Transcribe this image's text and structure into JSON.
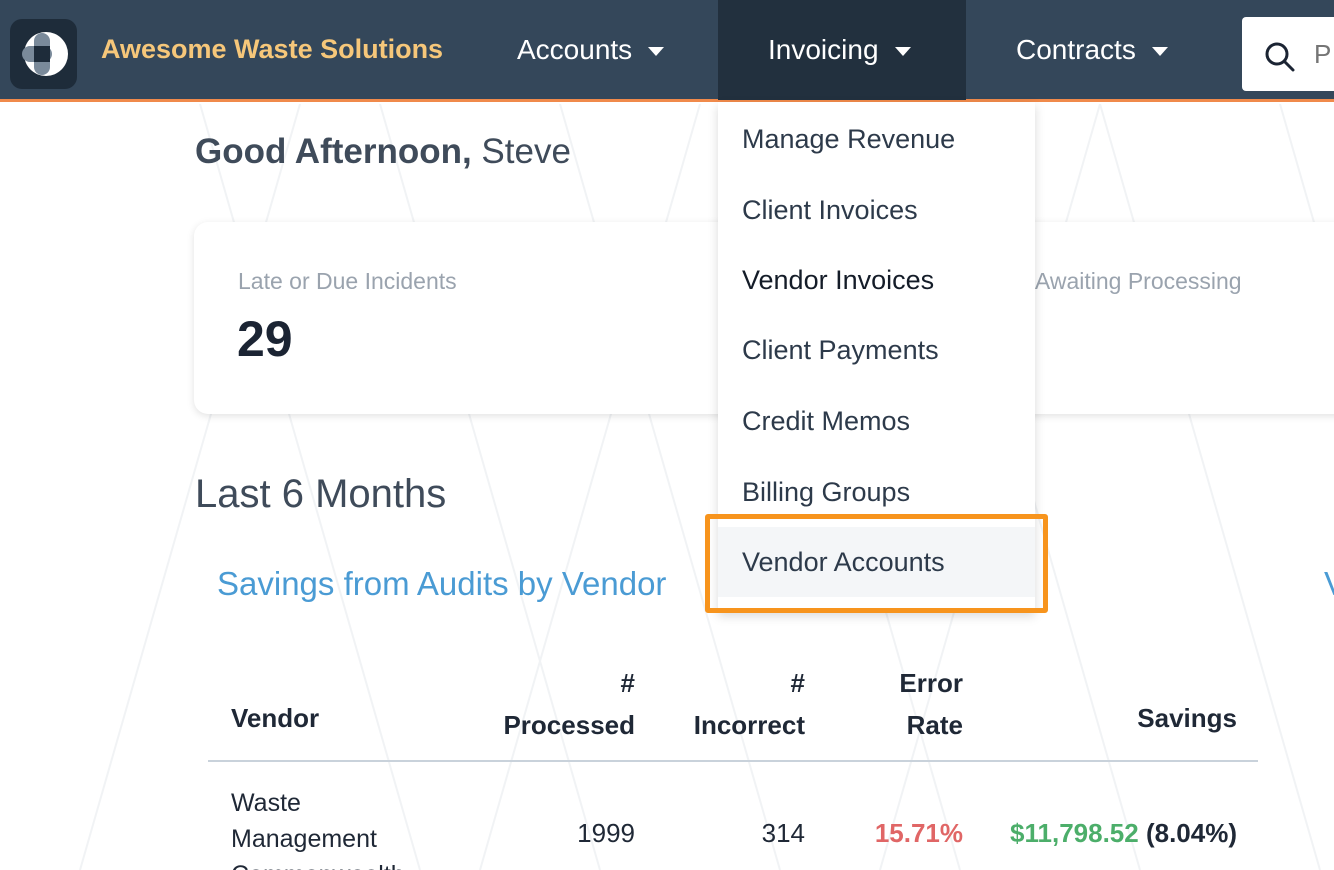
{
  "brand": {
    "name": "Awesome Waste Solutions"
  },
  "nav": {
    "accounts": "Accounts",
    "invoicing": "Invoicing",
    "contracts": "Contracts"
  },
  "search": {
    "placeholder": "P"
  },
  "greeting": {
    "salutation": "Good Afternoon,",
    "name": " Steve"
  },
  "stats": {
    "late_label": "Late or Due Incidents",
    "late_value": "29",
    "awaiting_label": "ces Awaiting Processing"
  },
  "section": {
    "title": "Last 6 Months"
  },
  "chart": {
    "title": "Savings from Audits by Vendor",
    "title_right": "V"
  },
  "table": {
    "headers": {
      "vendor": "Vendor",
      "processed_top": "#",
      "processed": "Processed",
      "incorrect_top": "#",
      "incorrect": "Incorrect",
      "error_top": "Error",
      "error": "Rate",
      "savings": "Savings"
    },
    "rows": [
      {
        "vendor_line1": "Waste",
        "vendor_line2": "Management",
        "vendor_line3": "Commonwealth",
        "processed": "1999",
        "incorrect": "314",
        "error_rate": "15.71%",
        "savings_amount": "$11,798.52",
        "savings_pct": " (8.04%)"
      }
    ]
  },
  "invoicing_menu": {
    "items": [
      "Manage Revenue",
      "Client Invoices",
      "Vendor Invoices",
      "Client Payments",
      "Credit Memos",
      "Billing Groups",
      "Vendor Accounts"
    ],
    "highlighted": "Vendor Accounts"
  },
  "colors": {
    "nav_bg": "#34475a",
    "nav_active_bg": "#22303e",
    "accent_border": "#f08a4b",
    "brand_text": "#f6c77a",
    "link_blue": "#4a9bd4",
    "error_red": "#e06666",
    "savings_green": "#4cae6a",
    "highlight_orange": "#f7941d"
  },
  "icons": {
    "logo": "logo-icon",
    "caret": "chevron-down-icon",
    "search": "search-icon"
  }
}
